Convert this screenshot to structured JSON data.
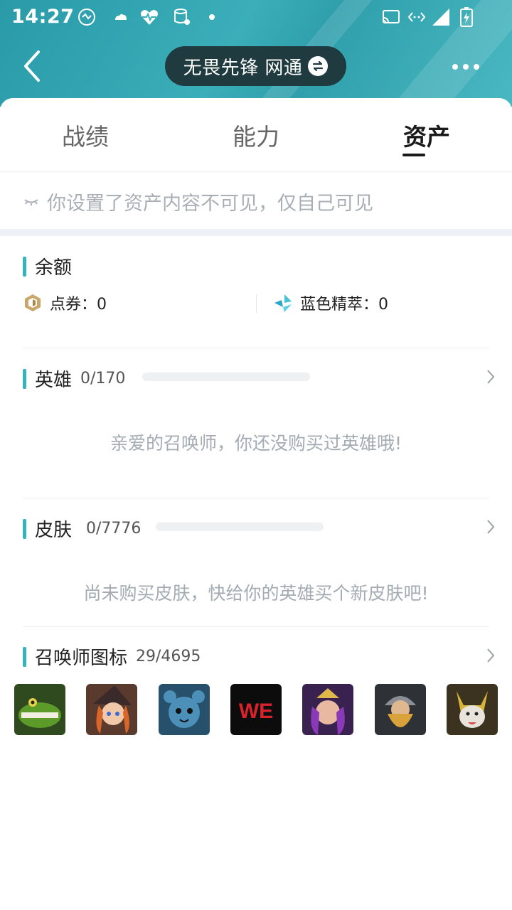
{
  "status": {
    "time": "14:27"
  },
  "nav": {
    "title": "无畏先锋 网通"
  },
  "tabs": [
    {
      "label": "战绩"
    },
    {
      "label": "能力"
    },
    {
      "label": "资产"
    }
  ],
  "notice": {
    "text": "你设置了资产内容不可见，仅自己可见"
  },
  "balance": {
    "title": "余额",
    "coupon_label": "点券：0",
    "essence_label": "蓝色精萃：0"
  },
  "heroes": {
    "title": "英雄",
    "count": "0/170",
    "progress": 0,
    "empty_text": "亲爱的召唤师，你还没购买过英雄哦!"
  },
  "skins": {
    "title": "皮肤",
    "count": "0/7776",
    "progress": 0,
    "empty_text": "尚未购买皮肤，快给你的英雄买个新皮肤吧!"
  },
  "icons": {
    "title": "召唤师图标",
    "count": "29/4695",
    "we_text": "WE"
  },
  "colors": {
    "accent": "#35b4c0",
    "header_bg": "#3aaeb9",
    "pill_bg": "#1f3b3f"
  }
}
